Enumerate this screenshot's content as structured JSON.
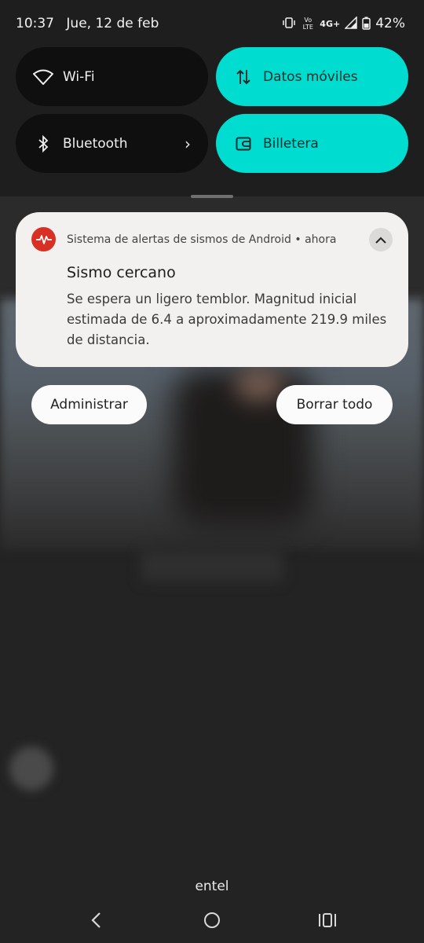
{
  "status_bar": {
    "time": "10:37",
    "date": "Jue, 12 de feb",
    "network": "4G+",
    "volte": "Vo LTE",
    "battery": "42%"
  },
  "quick_settings": {
    "tiles": [
      {
        "label": "Wi-Fi",
        "icon": "wifi-icon",
        "state": "off"
      },
      {
        "label": "Datos móviles",
        "icon": "mobile-data-icon",
        "state": "on"
      },
      {
        "label": "Bluetooth",
        "icon": "bluetooth-icon",
        "state": "off"
      },
      {
        "label": "Billetera",
        "icon": "wallet-icon",
        "state": "on"
      }
    ]
  },
  "notification": {
    "app_name": "Sistema de alertas de sismos de Android",
    "separator": "•",
    "time": "ahora",
    "title": "Sismo cercano",
    "body": "Se espera un ligero temblor. Magnitud inicial estimada de 6.4 a aproximadamente 219.9 miles de distancia.",
    "icon": "earthquake-alert-icon"
  },
  "actions": {
    "manage": "Administrar",
    "clear_all": "Borrar todo"
  },
  "carrier": "entel",
  "nav": {
    "back_icon": "back-icon",
    "home_icon": "home-icon",
    "recents_icon": "recents-icon"
  },
  "colors": {
    "accent": "#00dccf",
    "alert_red": "#d93025",
    "card": "#f3f1ef"
  }
}
